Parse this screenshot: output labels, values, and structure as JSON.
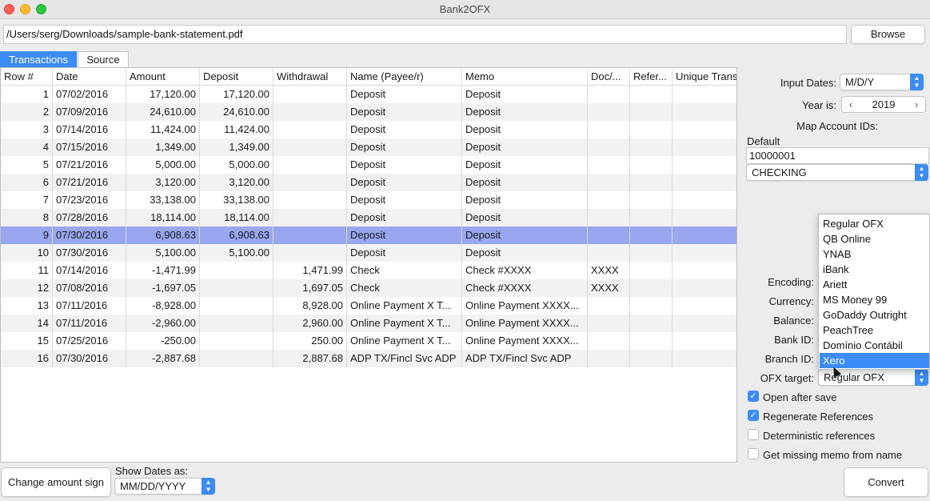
{
  "window": {
    "title": "Bank2OFX"
  },
  "path": {
    "value": "/Users/serg/Downloads/sample-bank-statement.pdf",
    "browse_label": "Browse"
  },
  "tabs": [
    {
      "label": "Transactions",
      "active": true
    },
    {
      "label": "Source",
      "active": false
    }
  ],
  "table": {
    "columns": [
      "Row #",
      "Date",
      "Amount",
      "Deposit",
      "Withdrawal",
      "Name (Payee/r)",
      "Memo",
      "Doc/...",
      "Refer...",
      "Unique Trans"
    ],
    "selected_row": 9,
    "rows": [
      [
        "1",
        "07/02/2016",
        "17,120.00",
        "17,120.00",
        "",
        "Deposit",
        "Deposit",
        "",
        "",
        ""
      ],
      [
        "2",
        "07/09/2016",
        "24,610.00",
        "24,610.00",
        "",
        "Deposit",
        "Deposit",
        "",
        "",
        ""
      ],
      [
        "3",
        "07/14/2016",
        "11,424.00",
        "11,424.00",
        "",
        "Deposit",
        "Deposit",
        "",
        "",
        ""
      ],
      [
        "4",
        "07/15/2016",
        "1,349.00",
        "1,349.00",
        "",
        "Deposit",
        "Deposit",
        "",
        "",
        ""
      ],
      [
        "5",
        "07/21/2016",
        "5,000.00",
        "5,000.00",
        "",
        "Deposit",
        "Deposit",
        "",
        "",
        ""
      ],
      [
        "6",
        "07/21/2016",
        "3,120.00",
        "3,120.00",
        "",
        "Deposit",
        "Deposit",
        "",
        "",
        ""
      ],
      [
        "7",
        "07/23/2016",
        "33,138.00",
        "33,138.00",
        "",
        "Deposit",
        "Deposit",
        "",
        "",
        ""
      ],
      [
        "8",
        "07/28/2016",
        "18,114.00",
        "18,114.00",
        "",
        "Deposit",
        "Deposit",
        "",
        "",
        ""
      ],
      [
        "9",
        "07/30/2016",
        "6,908.63",
        "6,908.63",
        "",
        "Deposit",
        "Deposit",
        "",
        "",
        ""
      ],
      [
        "10",
        "07/30/2016",
        "5,100.00",
        "5,100.00",
        "",
        "Deposit",
        "Deposit",
        "",
        "",
        ""
      ],
      [
        "11",
        "07/14/2016",
        "-1,471.99",
        "",
        "1,471.99",
        "Check",
        "Check #XXXX",
        "XXXX",
        "",
        ""
      ],
      [
        "12",
        "07/08/2016",
        "-1,697.05",
        "",
        "1,697.05",
        "Check",
        "Check #XXXX",
        "XXXX",
        "",
        ""
      ],
      [
        "13",
        "07/11/2016",
        "-8,928.00",
        "",
        "8,928.00",
        "Online Payment X T...",
        "Online Payment XXXX...",
        "",
        "",
        ""
      ],
      [
        "14",
        "07/11/2016",
        "-2,960.00",
        "",
        "2,960.00",
        "Online Payment X T...",
        "Online Payment XXXX...",
        "",
        "",
        ""
      ],
      [
        "15",
        "07/25/2016",
        "-250.00",
        "",
        "250.00",
        "Online Payment X T...",
        "Online Payment XXXX...",
        "",
        "",
        ""
      ],
      [
        "16",
        "07/30/2016",
        "-2,887.68",
        "",
        "2,887.68",
        "ADP TX/Fincl Svc ADP",
        "ADP TX/Fincl Svc ADP",
        "",
        "",
        ""
      ]
    ]
  },
  "settings": {
    "input_dates_label": "Input Dates:",
    "input_dates_value": "M/D/Y",
    "year_label": "Year is:",
    "year_value": "2019",
    "map_label": "Map Account IDs:",
    "default_label": "Default",
    "account_id": "10000001",
    "account_type": "CHECKING",
    "encoding_label": "Encoding:",
    "currency_label": "Currency:",
    "balance_label": "Balance:",
    "bank_id_label": "Bank ID:",
    "branch_id_label": "Branch ID:",
    "ofx_target_label": "OFX target:",
    "ofx_target_value": "Regular OFX",
    "ofx_target_options": [
      "Regular OFX",
      "QB Online",
      "YNAB",
      "iBank",
      "Ariett",
      "MS Money 99",
      "GoDaddy Outright",
      "PeachTree",
      "Domínio Contábil",
      "Xero"
    ],
    "ofx_target_highlighted": "Xero",
    "checkboxes": [
      {
        "label": "Open after save",
        "checked": true
      },
      {
        "label": "Regenerate References",
        "checked": true
      },
      {
        "label": "Deterministic references",
        "checked": false
      },
      {
        "label": "Get missing memo from name",
        "checked": false
      }
    ]
  },
  "bottom": {
    "change_sign_label": "Change amount sign",
    "show_dates_label": "Show Dates as:",
    "show_dates_value": "MM/DD/YYYY",
    "convert_label": "Convert"
  },
  "colors": {
    "accent": "#3b8cf6",
    "selected_row": "#99a6f0"
  }
}
